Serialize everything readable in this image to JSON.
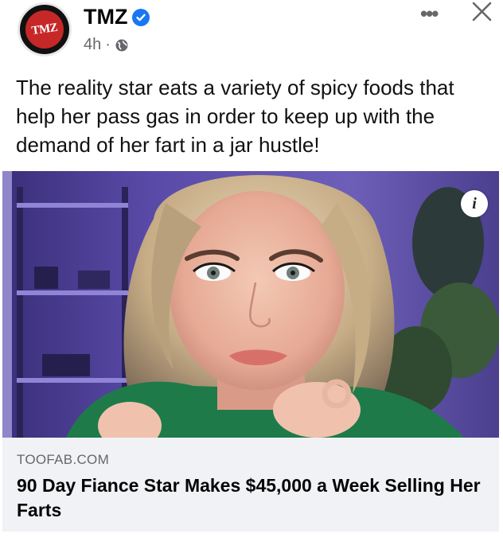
{
  "post": {
    "page_name": "TMZ",
    "avatar_text": "TMZ",
    "time": "4h",
    "separator": "·",
    "more_label": "•••",
    "caption": "The reality star eats a variety of spicy foods that help her pass gas in order to keep up with the demand of her fart in a jar hustle!"
  },
  "link_preview": {
    "source": "TOOFAB.COM",
    "headline": "90 Day Fiance Star Makes $45,000 a Week Selling Her Farts",
    "info_label": "i"
  },
  "colors": {
    "verified": "#1877f2",
    "avatar_red": "#c62828",
    "preview_bg": "#f0f2f5",
    "secondary_text": "#65676b"
  },
  "icons": [
    "verified-badge-icon",
    "globe-icon",
    "more-options-icon",
    "close-icon",
    "info-icon"
  ]
}
